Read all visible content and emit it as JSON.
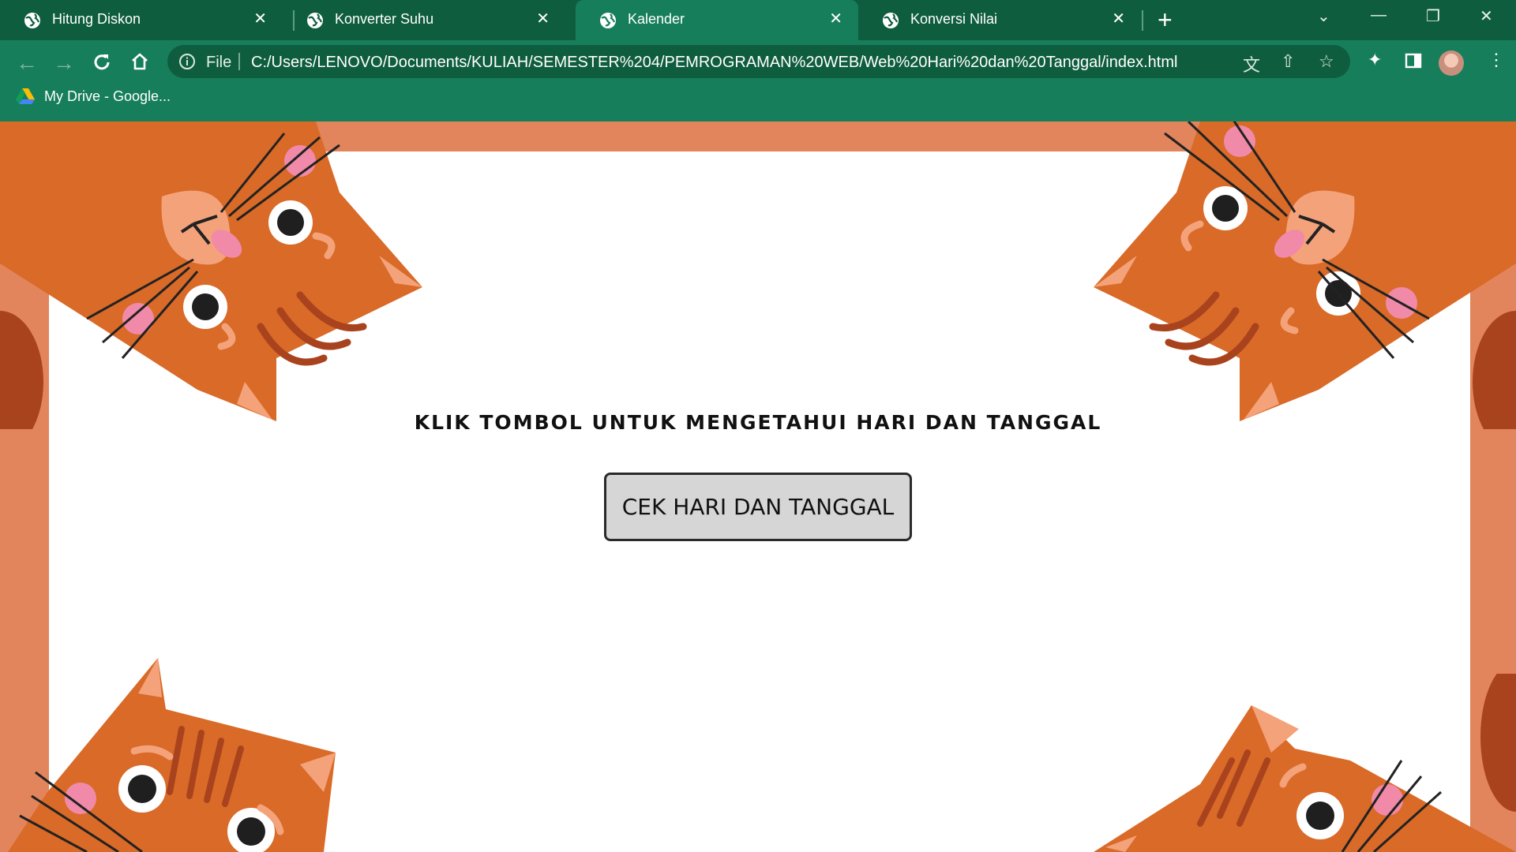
{
  "browser": {
    "tabs": [
      {
        "title": "Hitung Diskon",
        "active": false
      },
      {
        "title": "Konverter Suhu",
        "active": false
      },
      {
        "title": "Kalender",
        "active": true
      },
      {
        "title": "Konversi Nilai",
        "active": false
      }
    ],
    "tab_close_glyph": "✕",
    "new_tab_glyph": "+",
    "window_controls": {
      "dropdown": "⌄",
      "minimize": "—",
      "restore": "❐",
      "close": "✕"
    },
    "omnibox": {
      "scheme_label": "File",
      "url": "C:/Users/LENOVO/Documents/KULIAH/SEMESTER%204/PEMROGRAMAN%20WEB/Web%20Hari%20dan%20Tanggal/index.html"
    },
    "bookmarks": [
      {
        "label": "My Drive - Google..."
      }
    ],
    "colors": {
      "tabstrip": "#0f5d3f",
      "toolbar": "#177e5b",
      "active_tab": "#177e5b"
    }
  },
  "page": {
    "heading": "KLIK TOMBOL UNTUK MENGETAHUI HARI DAN TANGGAL",
    "button_label": "CEK HARI DAN TANGGAL",
    "colors": {
      "frame": "#e2855c",
      "cat_body": "#d96a28",
      "background": "#ffffff",
      "button": "#d6d6d6"
    }
  }
}
